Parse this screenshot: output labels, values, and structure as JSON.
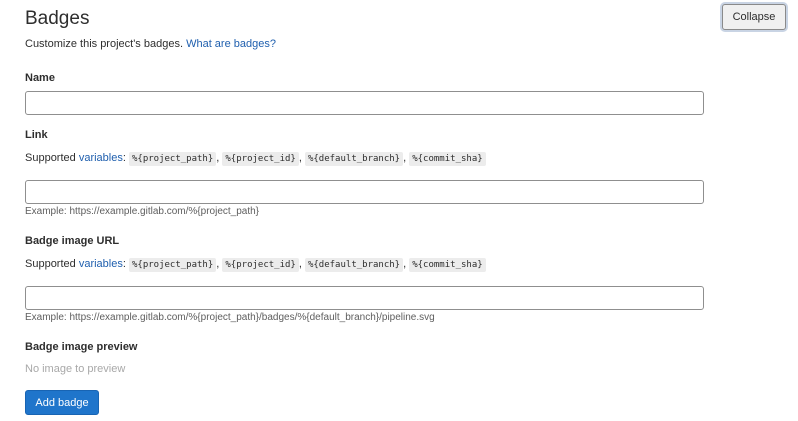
{
  "header": {
    "title": "Badges",
    "collapse_label": "Collapse"
  },
  "intro": {
    "text": "Customize this project's badges.",
    "link_label": "What are badges?"
  },
  "name_field": {
    "label": "Name",
    "value": ""
  },
  "link_field": {
    "label": "Link",
    "supported_prefix": "Supported",
    "variables_link": "variables",
    "variables": [
      "%{project_path}",
      "%{project_id}",
      "%{default_branch}",
      "%{commit_sha}"
    ],
    "value": "",
    "example": "Example: https://example.gitlab.com/%{project_path}"
  },
  "image_url_field": {
    "label": "Badge image URL",
    "supported_prefix": "Supported",
    "variables_link": "variables",
    "variables": [
      "%{project_path}",
      "%{project_id}",
      "%{default_branch}",
      "%{commit_sha}"
    ],
    "value": "",
    "example": "Example: https://example.gitlab.com/%{project_path}/badges/%{default_branch}/pipeline.svg"
  },
  "preview": {
    "label": "Badge image preview",
    "empty_text": "No image to preview"
  },
  "add_badge_label": "Add badge",
  "colors": {
    "primary": "#1f75cb",
    "link": "#1f5fae"
  }
}
